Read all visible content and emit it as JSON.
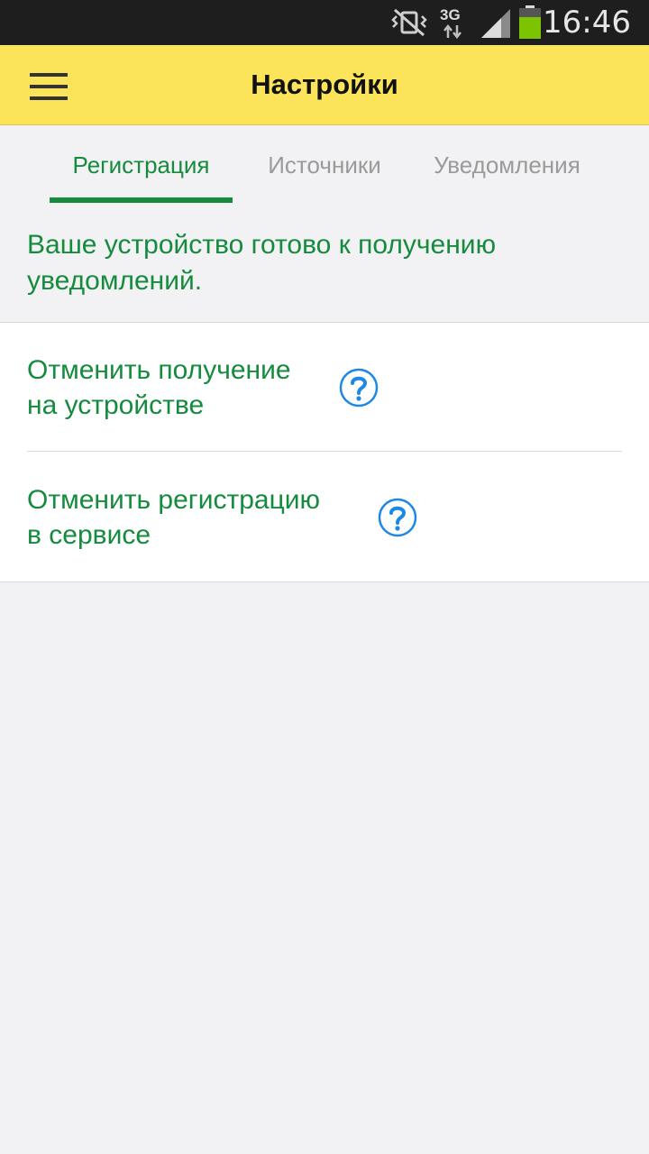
{
  "status_bar": {
    "network_type": "3G",
    "time": "16:46",
    "icons": [
      "vibrate-icon",
      "network-3g-icon",
      "signal-icon",
      "battery-icon"
    ],
    "battery_color": "#7dc400"
  },
  "toolbar": {
    "title": "Настройки",
    "menu_icon": "hamburger-menu-icon",
    "background": "#fce45a"
  },
  "tabs": [
    {
      "label": "Регистрация",
      "active": true
    },
    {
      "label": "Источники",
      "active": false
    },
    {
      "label": "Уведомления",
      "active": false
    }
  ],
  "status_message": "Ваше устройство готово к получению уведомлений.",
  "settings": {
    "items": [
      {
        "line1": "Отменить получение",
        "line2": "на устройстве",
        "icon": "help-icon"
      },
      {
        "line1": "Отменить регистрацию",
        "line2": "в сервисе",
        "icon": "help-icon"
      }
    ]
  },
  "colors": {
    "accent_green": "#158b3e",
    "help_blue": "#1e88e5",
    "inactive_tab": "#9a9a9a"
  }
}
